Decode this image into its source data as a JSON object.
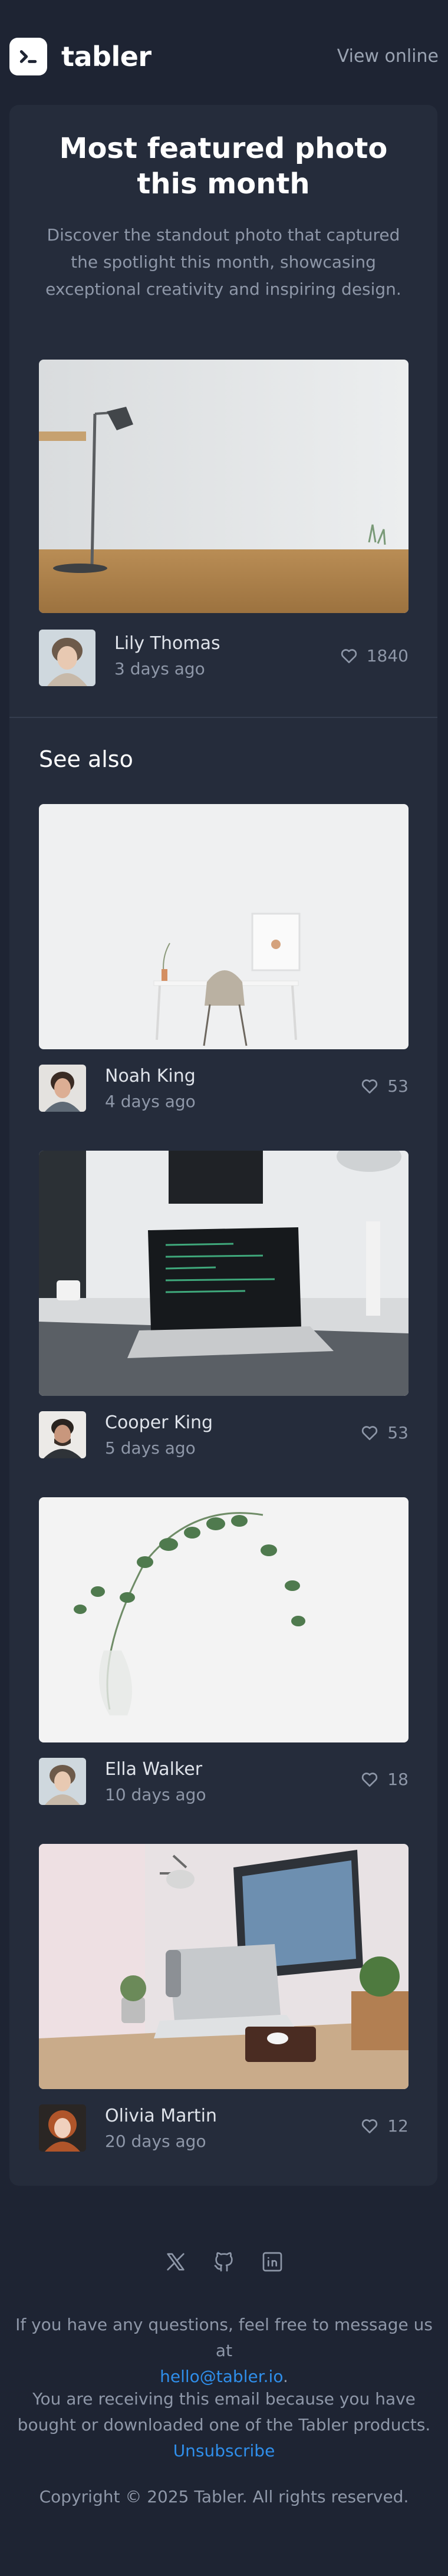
{
  "header": {
    "brand": "tabler",
    "view_online": "View online"
  },
  "hero": {
    "title": "Most featured photo this month",
    "description": "Discover the standout photo that captured the spotlight this month, showcasing exceptional creativity and inspiring design."
  },
  "featured": {
    "author": "Lily Thomas",
    "time": "3 days ago",
    "likes": "1840"
  },
  "see_also": {
    "heading": "See also",
    "items": [
      {
        "author": "Noah King",
        "time": "4 days ago",
        "likes": "53"
      },
      {
        "author": "Cooper King",
        "time": "5 days ago",
        "likes": "53"
      },
      {
        "author": "Ella Walker",
        "time": "10 days ago",
        "likes": "18"
      },
      {
        "author": "Olivia Martin",
        "time": "20 days ago",
        "likes": "12"
      }
    ]
  },
  "footer": {
    "social_icons": [
      "x-icon",
      "github-icon",
      "linkedin-icon"
    ],
    "questions_text": "If you have any questions, feel free to message us at",
    "email": "hello@tabler.io",
    "email_suffix": ".",
    "receiving_text": "You are receiving this email because you have bought or downloaded one of the Tabler products.",
    "unsubscribe": "Unsubscribe",
    "copyright": "Copyright © 2025 Tabler. All rights reserved."
  },
  "colors": {
    "background": "#1e2433",
    "card": "#252c3b",
    "link": "#2f8eea"
  }
}
